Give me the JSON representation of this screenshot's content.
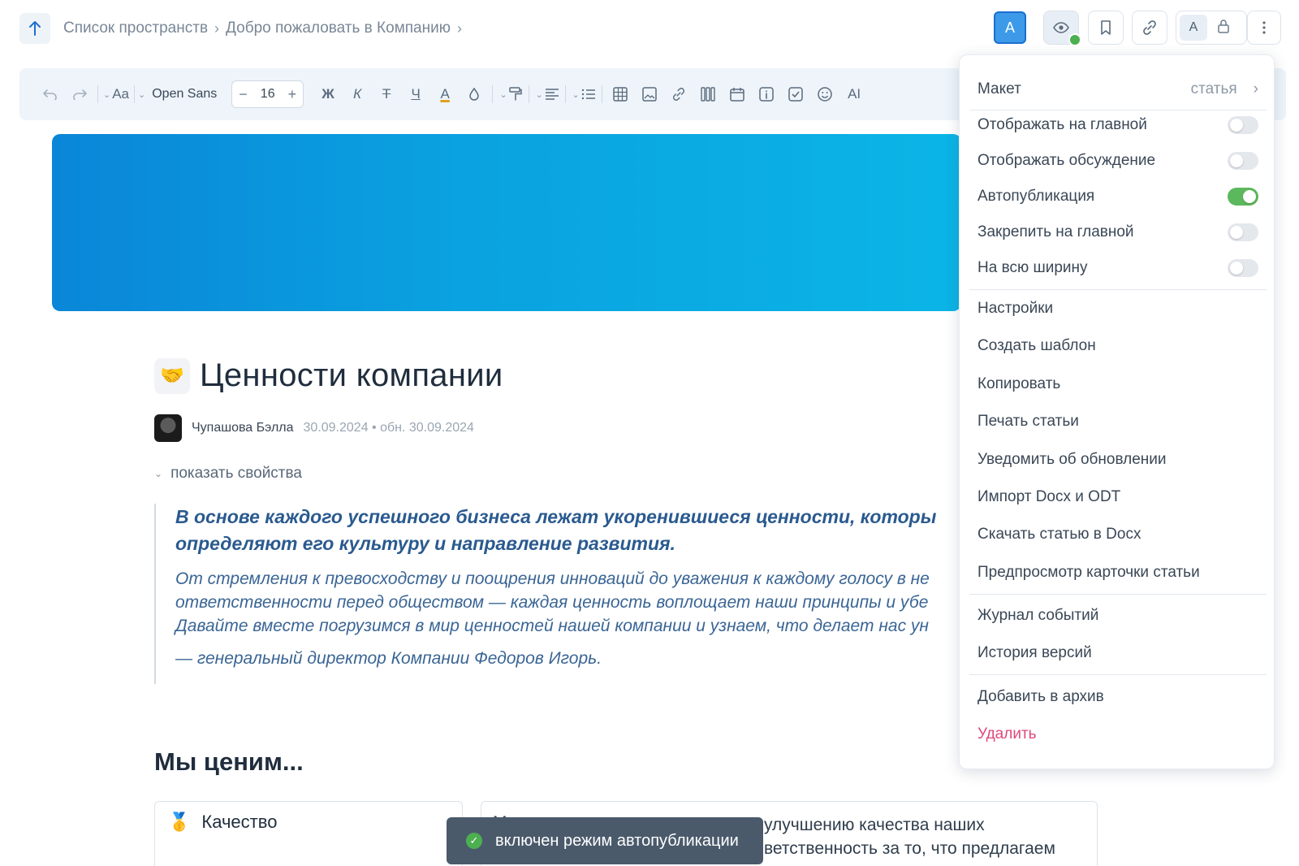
{
  "header": {
    "up_icon": "arrow-up-icon",
    "breadcrumb": [
      {
        "label": "Список пространств"
      },
      {
        "label": "Добро пожаловать в Компанию"
      }
    ],
    "user_initial": "A",
    "lang_initial": "A",
    "icons": [
      "eye-icon",
      "bookmark-icon",
      "link-icon",
      "lock-icon",
      "more-vertical-icon"
    ],
    "eye_status_color": "#4caf50"
  },
  "toolbar": {
    "font_name": "Open Sans",
    "font_size": "16",
    "bold": "Ж",
    "italic": "К",
    "strike": "Т",
    "underline": "Ч",
    "text_color": "A",
    "ai": "AI",
    "textsize": "Aa"
  },
  "article": {
    "title": "Ценности компании",
    "title_icon": "handshake-icon",
    "author": "Чупашова Бэлла",
    "dates": "30.09.2024 • обн. 30.09.2024",
    "show_props": "показать свойства",
    "quote_lead_1": "В основе каждого успешного бизнеса лежат укоренившиеся ценности, которы",
    "quote_lead_2": "определяют его культуру и направление развития.",
    "quote_body_1": "От стремления к превосходству и поощрения инноваций до уважения к каждому голосу в не",
    "quote_body_2": "ответственности перед обществом — каждая ценность воплощает наши принципы и убе",
    "quote_body_3": "Давайте вместе погрузимся в мир ценностей нашей компании и узнаем, что делает нас ун",
    "quote_sign": "— генеральный директор Компании Федоров Игорь.",
    "section_heading": "Мы ценим...",
    "card1_title": "Качество",
    "card2_m": "М",
    "card2_line1": "улучшению качества наших",
    "card2_line2": "ветственность за то, что предлагаем"
  },
  "menu": {
    "layout_label": "Макет",
    "layout_value": "статья",
    "toggles": [
      {
        "label": "Отображать на главной",
        "on": false
      },
      {
        "label": "Отображать обсуждение",
        "on": false
      },
      {
        "label": "Автопубликация",
        "on": true
      },
      {
        "label": "Закрепить на главной",
        "on": false
      },
      {
        "label": "На всю ширину",
        "on": false
      }
    ],
    "actions": [
      "Настройки",
      "Создать шаблон",
      "Копировать",
      "Печать статьи",
      "Уведомить об обновлении",
      "Импорт Docx и ODT",
      "Скачать статью в Docx",
      "Предпросмотр карточки статьи"
    ],
    "journal": "Журнал событий",
    "history": "История версий",
    "archive": "Добавить в архив",
    "delete": "Удалить",
    "toggle_on_color": "#5cb85c",
    "danger_color": "#e0487a"
  },
  "toast": {
    "text": "включен режим автопубликации",
    "icon": "check-circle-icon"
  }
}
